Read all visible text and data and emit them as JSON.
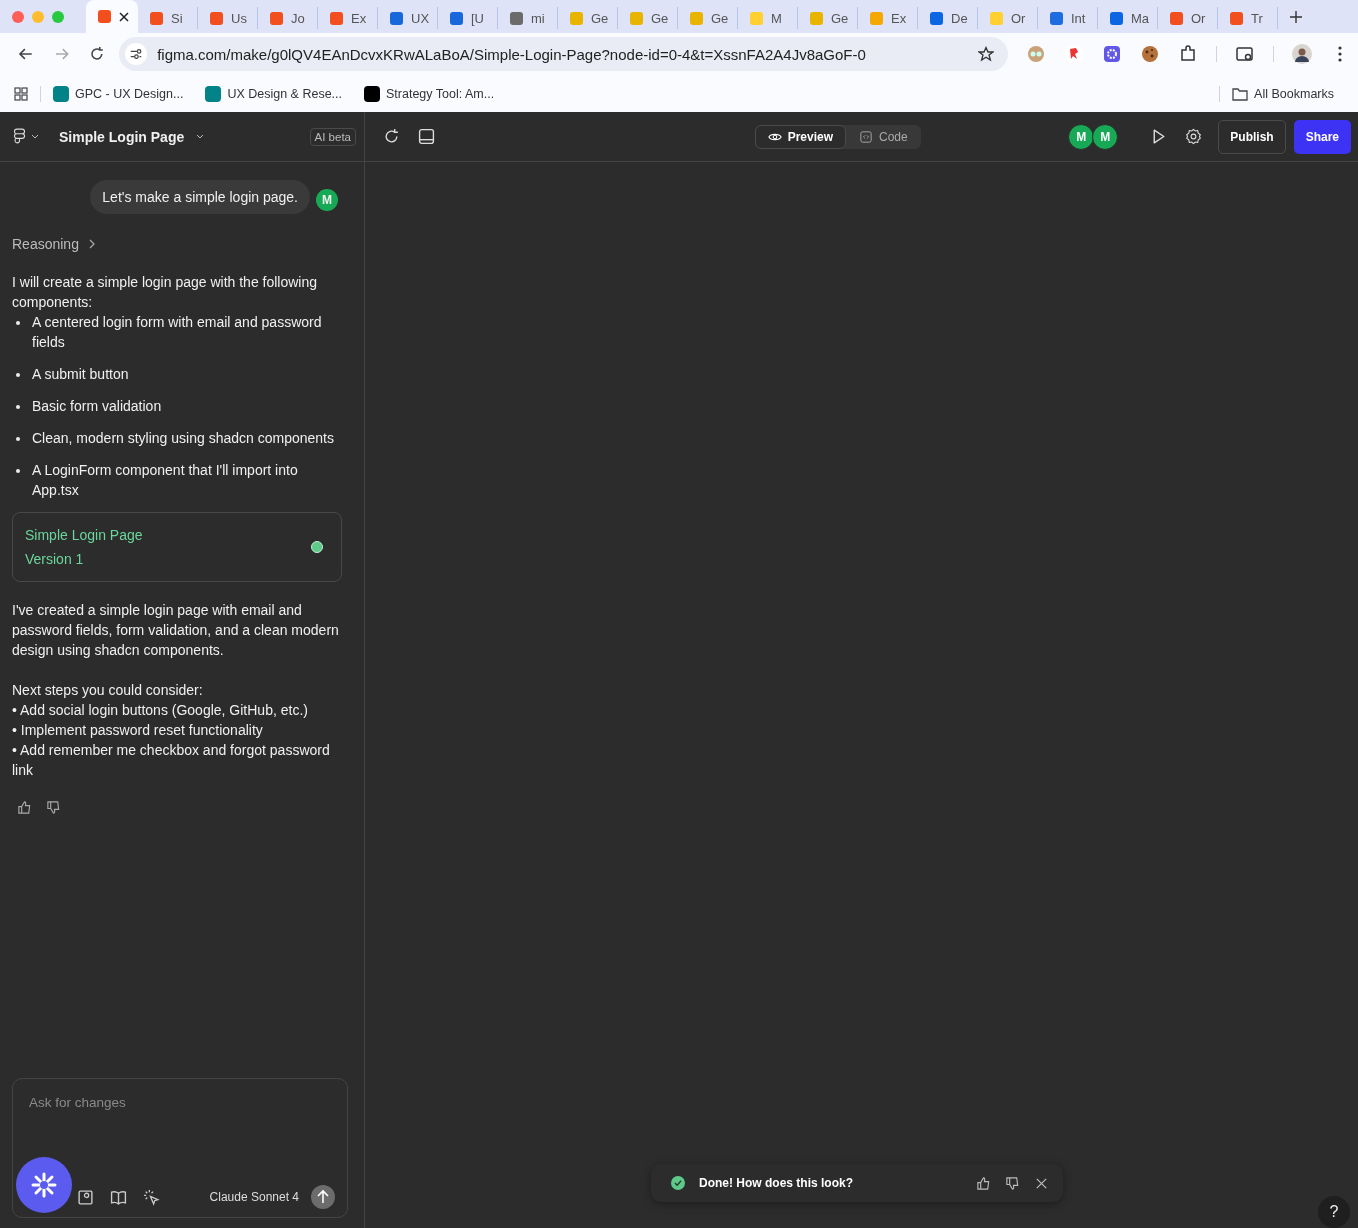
{
  "browser": {
    "tabs": [
      {
        "selected": true,
        "color": "#f24e1e"
      },
      {
        "title": "Si",
        "selected": false,
        "color": "#f24e1e"
      },
      {
        "title": "Us",
        "selected": false,
        "color": "#f24e1e"
      },
      {
        "title": "Jo",
        "selected": false,
        "color": "#f24e1e"
      },
      {
        "title": "Ex",
        "selected": false,
        "color": "#f24e1e"
      },
      {
        "title": "UX",
        "selected": false,
        "color": "#1868db"
      },
      {
        "title": "[U",
        "selected": false,
        "color": "#1868db"
      },
      {
        "title": "mi",
        "selected": false,
        "color": "#6b6b6b"
      },
      {
        "title": "Ge",
        "selected": false,
        "color": "#e8b400"
      },
      {
        "title": "Ge",
        "selected": false,
        "color": "#e8b400"
      },
      {
        "title": "Ge",
        "selected": false,
        "color": "#e8b400"
      },
      {
        "title": "M",
        "selected": false,
        "color": "#ffd02f"
      },
      {
        "title": "Ge",
        "selected": false,
        "color": "#e8b400"
      },
      {
        "title": "Ex",
        "selected": false,
        "color": "#f5a800"
      },
      {
        "title": "De",
        "selected": false,
        "color": "#0c66e4"
      },
      {
        "title": "Or",
        "selected": false,
        "color": "#ffd02f"
      },
      {
        "title": "Int",
        "selected": false,
        "color": "#1d6ce0"
      },
      {
        "title": "Ma",
        "selected": false,
        "color": "#0c66e4"
      },
      {
        "title": "Or",
        "selected": false,
        "color": "#f24e1e"
      },
      {
        "title": "Tr",
        "selected": false,
        "color": "#f24e1e"
      }
    ],
    "address": "figma.com/make/g0lQV4EAnDcvxKRwALaBoA/Simple-Login-Page?node-id=0-4&t=XssnFA2A4Jv8aGoF-0",
    "bookmarks": [
      {
        "label": "GPC - UX Design...",
        "color": "#038387"
      },
      {
        "label": "UX Design & Rese...",
        "color": "#038387"
      },
      {
        "label": "Strategy Tool: Am...",
        "color": "#000000"
      }
    ],
    "all_bookmarks": "All Bookmarks"
  },
  "app": {
    "project": "Simple Login Page",
    "badge": "AI beta",
    "view_toggle": [
      {
        "label": "Preview",
        "selected": true
      },
      {
        "label": "Code",
        "selected": false
      }
    ],
    "avatars": [
      "M",
      "M"
    ],
    "publish": "Publish",
    "share": "Share"
  },
  "chat": {
    "user_message": "Let's make a simple login page.",
    "user_avatar": "M",
    "reasoning": "Reasoning",
    "intro": "I will create a simple login page with the following components:",
    "bullets": [
      "A centered login form with email and password fields",
      "A submit button",
      "Basic form validation",
      "Clean, modern styling using shadcn components",
      "A LoginForm component that I'll import into App.tsx"
    ],
    "version_card": {
      "title": "Simple Login Page",
      "version": "Version 1"
    },
    "summary": "I've created a simple login page with email and password fields, form validation, and a clean modern design using shadcn components.",
    "next_heading": "Next steps you could consider:",
    "next_steps": [
      "• Add social login buttons (Google, GitHub, etc.)",
      "• Implement password reset functionality",
      "• Add remember me checkbox and forgot password link"
    ]
  },
  "input": {
    "placeholder": "Ask for changes",
    "model": "Claude Sonnet 4"
  },
  "toast": {
    "message": "Done! How does this look?"
  },
  "help": "?"
}
